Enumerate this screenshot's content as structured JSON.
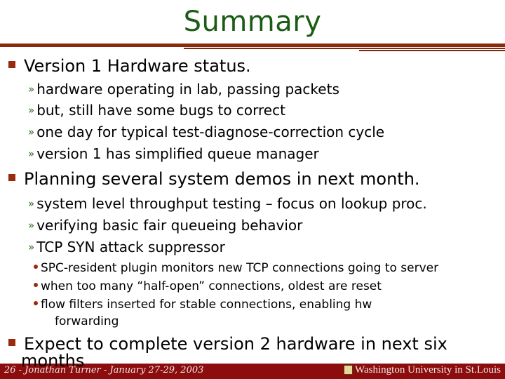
{
  "slide": {
    "title": "Summary",
    "bullets": [
      {
        "text": "Version 1 Hardware status.",
        "sub": [
          "hardware operating in lab, passing packets",
          "but, still have some bugs to correct",
          "one day for typical test-diagnose-correction cycle",
          "version 1 has simplified queue manager"
        ]
      },
      {
        "text": "Planning several system demos in next month.",
        "sub": [
          "system level throughput testing – focus on lookup proc.",
          "verifying basic fair queueing behavior",
          "TCP SYN attack suppressor"
        ],
        "subsub": [
          "SPC-resident plugin monitors new TCP connections going to server",
          "when too many “half-open” connections, oldest are reset",
          "flow filters inserted for stable connections, enabling hw",
          "forwarding"
        ]
      },
      {
        "text": "Expect to complete version 2 hardware in next six",
        "overflow": "months"
      }
    ]
  },
  "footer": {
    "left": "26 - Jonathan Turner - January 27-29, 2003",
    "right": "Washington University in St.Louis"
  },
  "colors": {
    "title": "#1a5c14",
    "bullet": "#9a2a0c",
    "footer_bg": "#8b0d0d",
    "rule": "#8b2a0a"
  },
  "icons": {
    "bullet_l1": "square-bullet-icon",
    "bullet_l2": "double-chevron-icon",
    "bullet_l3": "dot-bullet-icon",
    "footer_logo": "university-shield-icon"
  }
}
